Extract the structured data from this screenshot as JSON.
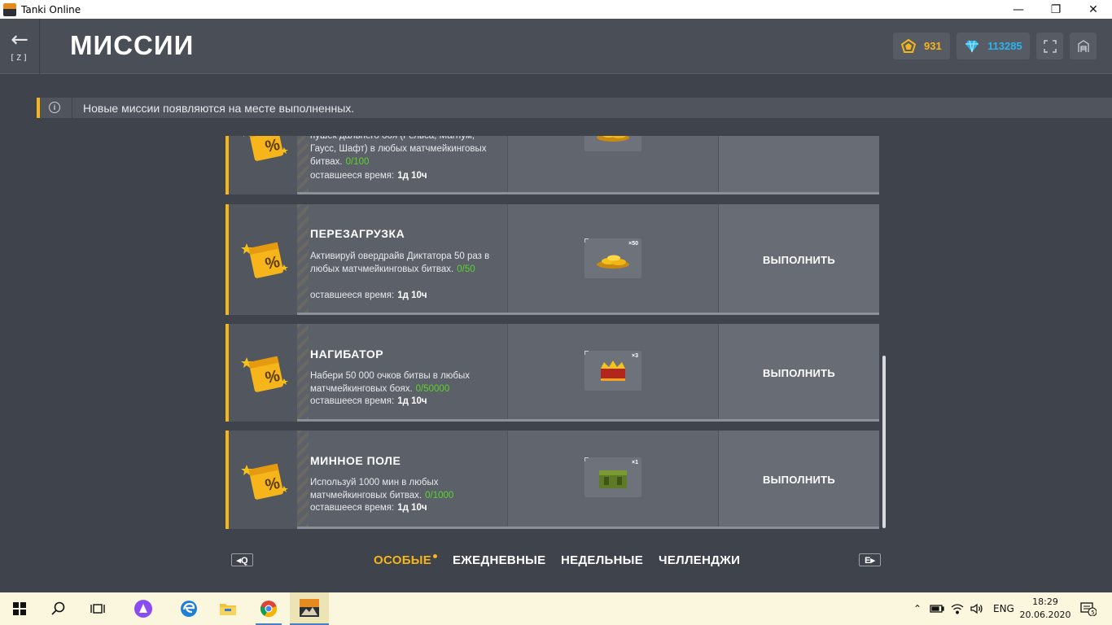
{
  "window": {
    "title": "Tanki Online",
    "minimize_glyph": "—",
    "maximize_glyph": "❐",
    "close_glyph": "✕"
  },
  "header": {
    "back_arrow": "←",
    "back_hotkey": "[Z]",
    "title": "МИССИИ",
    "stars_count": "931",
    "crystals_count": "113285"
  },
  "banner": {
    "text": "Новые миссии появляются на месте выполненных."
  },
  "missions": [
    {
      "name": "",
      "desc": "пушек дальнего боя (Рельса, Магнум, Гаусс, Шафт) в любых матчмейкинговых битвах.",
      "progress": "0/100",
      "remaining_label": "оставшееся время:",
      "remaining_value": "1д 10ч",
      "reward_qty": "",
      "reward_icon": "gold-coins-icon",
      "action": ""
    },
    {
      "name": "ПЕРЕЗАГРУЗКА",
      "desc": "Активируй овердрайв Диктатора 50 раз в любых матчмейкинговых битвах.",
      "progress": "0/50",
      "remaining_label": "оставшееся время:",
      "remaining_value": "1д 10ч",
      "reward_qty": "×50",
      "reward_icon": "gold-coins-icon",
      "action": "ВЫПОЛНИТЬ"
    },
    {
      "name": "НАГИБАТОР",
      "desc": "Набери 50 000 очков битвы в любых матчмейкинговых боях.",
      "progress": "0/50000",
      "remaining_label": "оставшееся время:",
      "remaining_value": "1д 10ч",
      "reward_qty": "×3",
      "reward_icon": "crown-container-icon",
      "action": "ВЫПОЛНИТЬ"
    },
    {
      "name": "МИННОЕ ПОЛЕ",
      "desc": "Используй 1000 мин в любых матчмейкинговых битвах.",
      "progress": "0/1000",
      "remaining_label": "оставшееся время:",
      "remaining_value": "1д 10ч",
      "reward_qty": "×1",
      "reward_icon": "green-container-icon",
      "action": "ВЫПОЛНИТЬ"
    }
  ],
  "tabs": {
    "prev_key": "◂Q",
    "next_key": "E▸",
    "items": [
      "ОСОБЫЕ",
      "ЕЖЕДНЕВНЫЕ",
      "НЕДЕЛЬНЫЕ",
      "ЧЕЛЛЕНДЖИ"
    ],
    "active": "ОСОБЫЕ"
  },
  "taskbar": {
    "language": "ENG",
    "time": "18:29",
    "date": "20.06.2020",
    "notifications": "5"
  },
  "colors": {
    "accent": "#f5b51b",
    "progress": "#5bd42a",
    "crystal": "#2ab4f0"
  }
}
